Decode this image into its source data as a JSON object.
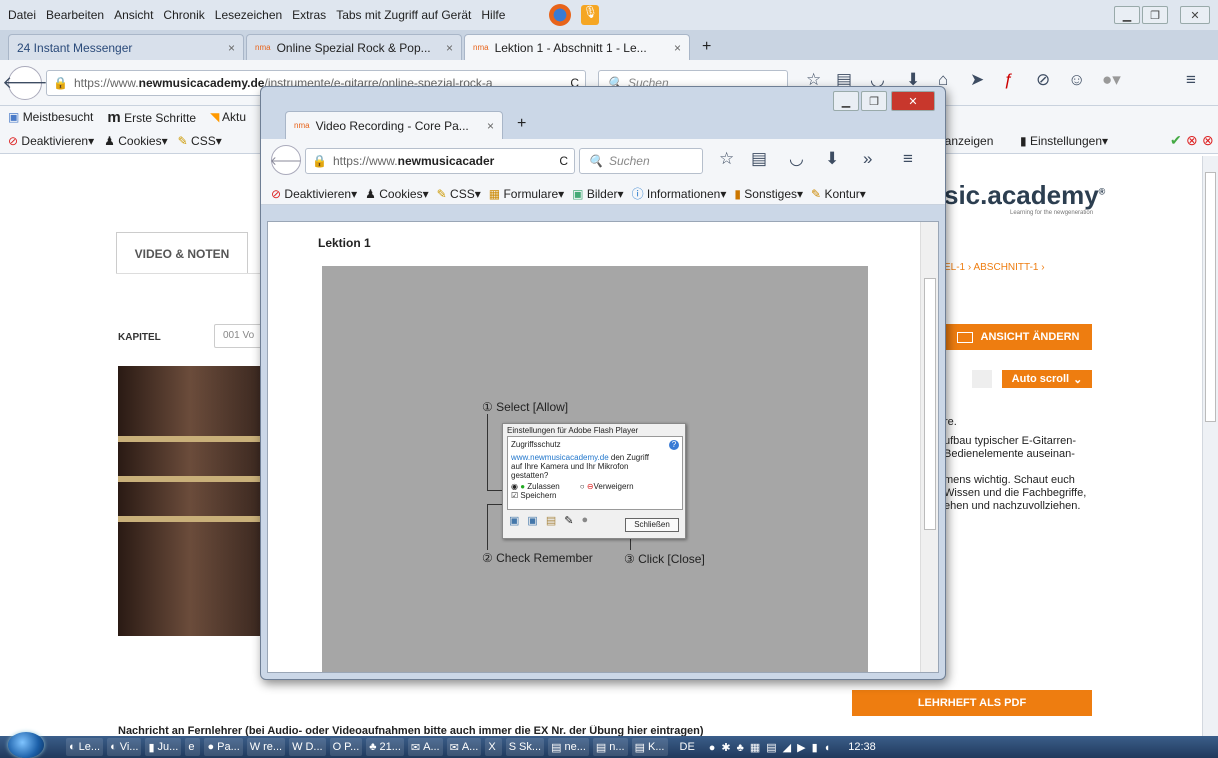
{
  "menubar": {
    "items": [
      "Datei",
      "Bearbeiten",
      "Ansicht",
      "Chronik",
      "Lesezeichen",
      "Extras",
      "Tabs mit Zugriff auf Gerät",
      "Hilfe"
    ]
  },
  "tabs": [
    {
      "label": "24 Instant Messenger"
    },
    {
      "label": "Online Spezial Rock & Pop..."
    },
    {
      "label": "Lektion 1 - Abschnitt 1 - Le..."
    }
  ],
  "newtab": "+",
  "nav": {
    "url_prefix": "https://www.",
    "url_domain": "newmusicacademy.de",
    "url_path": "/instrumente/e-gitarre/online-spezial-rock-a",
    "search_placeholder": "Suchen"
  },
  "bookmarks": [
    "Meistbesucht",
    "Erste Schritte",
    "Aktu"
  ],
  "toolbar": {
    "items": [
      "Deaktivieren",
      "Cookies",
      "CSS"
    ],
    "right": [
      "t anzeigen",
      "Einstellungen"
    ]
  },
  "page": {
    "tab_video": "VIDEO & NOTEN",
    "kapitel_label": "KAPITEL",
    "kapitel_value": "001 Vo",
    "logo": "sic.academy",
    "logo_reg": "®",
    "logo_sub": "Learning for the newgeneration",
    "breadcrumb": "EL-1 › ABSCHNITT-1 ›",
    "ansicht_button": "ANSICHT ÄNDERN",
    "autoscroll_button": "Auto scroll",
    "text_lines": [
      "re.",
      "ufbau typischer E-Gitarren-",
      "Bedienelemente auseinan-",
      "",
      "mens wichtig. Schaut euch",
      "Wissen und die Fachbegriffe,",
      "ehen und nachzuvollziehen."
    ],
    "pdf_button": "LEHRHEFT ALS PDF",
    "bottom_text": "Nachricht an Fernlehrer (bei Audio- oder Videoaufnahmen bitte auch immer die EX Nr. der Übung hier eintragen)"
  },
  "popup": {
    "tab_label": "Video Recording - Core Pa...",
    "url_prefix": "https://www.",
    "url_domain": "newmusicacader",
    "search_placeholder": "Suchen",
    "toolbar": [
      "Deaktivieren",
      "Cookies",
      "CSS",
      "Formulare",
      "Bilder",
      "Informationen",
      "Sonstiges",
      "Kontur"
    ],
    "heading": "Lektion 1",
    "annot1": "① Select [Allow]",
    "annot2": "② Check Remember",
    "annot3": "③ Click [Close]",
    "flash": {
      "title": "Einstellungen für Adobe Flash Player",
      "section": "Zugriffsschutz",
      "site": "www.newmusicacademy.de",
      "text1": " den Zugriff",
      "text2": "auf Ihre Kamera und Ihr Mikrofon",
      "text3": "gestatten?",
      "allow": "Zulassen",
      "deny": "Verweigern",
      "remember": "Speichern",
      "close": "Schließen"
    }
  },
  "taskbar": {
    "items": [
      "Le...",
      "Vi...",
      "Ju...",
      "",
      "Pa...",
      "re...",
      "D...",
      "P...",
      "21...",
      "A...",
      "A...",
      "",
      "Sk...",
      "ne...",
      "n...",
      "K..."
    ],
    "lang": "DE",
    "time": "12:38"
  },
  "colors": {
    "accent": "#ee7d10"
  }
}
